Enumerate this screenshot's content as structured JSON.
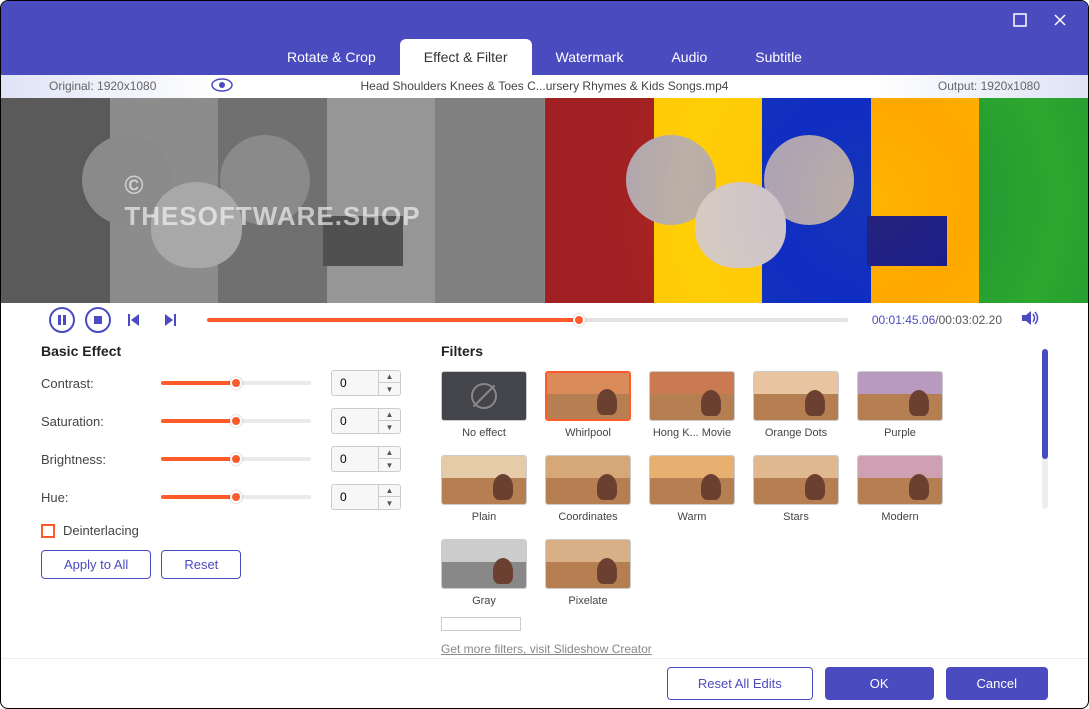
{
  "tabs": [
    "Rotate & Crop",
    "Effect & Filter",
    "Watermark",
    "Audio",
    "Subtitle"
  ],
  "active_tab": 1,
  "info": {
    "original": "Original: 1920x1080",
    "filename": "Head Shoulders Knees & Toes  C...ursery Rhymes & Kids Songs.mp4",
    "output": "Output: 1920x1080"
  },
  "watermark_text": "© THESOFTWARE.SHOP",
  "playback": {
    "current": "00:01:45.06",
    "total": "/00:03:02.20",
    "progress_pct": 58
  },
  "basic_effect": {
    "title": "Basic Effect",
    "rows": [
      {
        "label": "Contrast:",
        "value": 0,
        "slider_pct": 50
      },
      {
        "label": "Saturation:",
        "value": 0,
        "slider_pct": 50
      },
      {
        "label": "Brightness:",
        "value": 0,
        "slider_pct": 50
      },
      {
        "label": "Hue:",
        "value": 0,
        "slider_pct": 50
      }
    ],
    "deinterlacing": "Deinterlacing",
    "apply_all": "Apply to All",
    "reset": "Reset"
  },
  "filters": {
    "title": "Filters",
    "items": [
      {
        "name": "No effect",
        "kind": "noeffect"
      },
      {
        "name": "Whirlpool",
        "sky": "#d98b5a"
      },
      {
        "name": "Hong K... Movie",
        "sky": "#c97a50"
      },
      {
        "name": "Orange Dots",
        "sky": "#e8c4a0"
      },
      {
        "name": "Purple",
        "sky": "#b89ac0"
      },
      {
        "name": "Plain",
        "sky": "#e6cba8"
      },
      {
        "name": "Coordinates",
        "sky": "#d6a878"
      },
      {
        "name": "Warm",
        "sky": "#e8b070"
      },
      {
        "name": "Stars",
        "sky": "#e0b890"
      },
      {
        "name": "Modern",
        "sky": "#cfa0b2"
      },
      {
        "name": "Gray",
        "sky": "#cccccc",
        "land": "#888888"
      },
      {
        "name": "Pixelate",
        "sky": "#d8b088"
      }
    ],
    "selected": 1,
    "link": "Get more filters, visit Slideshow Creator"
  },
  "footer": {
    "reset_all": "Reset All Edits",
    "ok": "OK",
    "cancel": "Cancel"
  }
}
